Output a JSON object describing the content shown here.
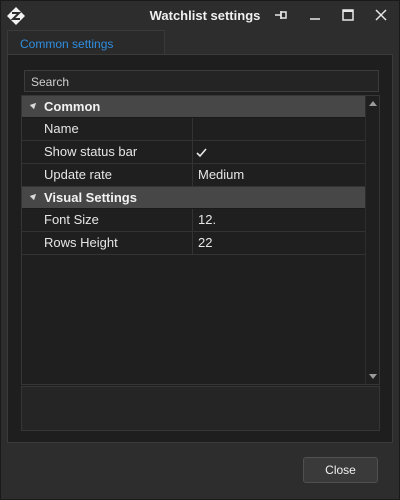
{
  "window": {
    "title": "Watchlist settings"
  },
  "tabs": [
    {
      "label": "Common settings",
      "active": true
    }
  ],
  "search": {
    "placeholder": "Search"
  },
  "grid": {
    "categories": [
      {
        "label": "Common",
        "properties": [
          {
            "name": "Name",
            "value": ""
          },
          {
            "name": "Show status bar",
            "value": "checked"
          },
          {
            "name": "Update rate",
            "value": "Medium"
          }
        ]
      },
      {
        "label": "Visual Settings",
        "properties": [
          {
            "name": "Font Size",
            "value": "12."
          },
          {
            "name": "Rows Height",
            "value": "22"
          }
        ]
      }
    ]
  },
  "footer": {
    "close_label": "Close"
  },
  "colors": {
    "accent": "#2f8ee0",
    "background": "#2d2d2d",
    "category_bar": "#474747"
  },
  "icons": [
    "app-logo-icon",
    "pin-icon",
    "minimize-icon",
    "maximize-icon",
    "close-icon",
    "collapse-triangle-icon",
    "checkmark-icon",
    "scroll-up-arrow-icon",
    "scroll-down-arrow-icon"
  ]
}
